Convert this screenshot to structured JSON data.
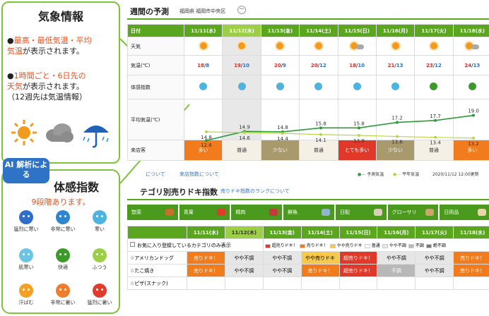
{
  "info_box": {
    "title": "気象情報",
    "b1_part1": "最高・最低気温・平均",
    "b1_part2": "気温",
    "b1_part3": "が表示されます。",
    "b2_part1": "1時間ごと・6日先の",
    "b2_part2": "天気",
    "b2_part3": "が表示されます。",
    "b2_note": "（12週先は気温情報）"
  },
  "index_box": {
    "ai_tag": "AI 解析による",
    "title": "体感指数",
    "subtitle": "9段階あります。",
    "levels": [
      "猛烈に寒い",
      "非常に寒い",
      "寒い",
      "肌寒い",
      "快適",
      "ふつう",
      "汗ばむ",
      "非常に暑い",
      "猛烈に暑い"
    ],
    "colors": [
      "#2f6fc9",
      "#2f85cf",
      "#4db3e0",
      "#6ac6e3",
      "#3c9a2a",
      "#9ccf46",
      "#f2a125",
      "#f07c2e",
      "#e03c2c"
    ]
  },
  "forecast": {
    "title": "週間の予測",
    "location": "福岡県 福岡市中央区",
    "row_labels": [
      "日付",
      "天気",
      "気温(℃)",
      "体感指数",
      "平均気温(℃)",
      "来店客"
    ],
    "dates": [
      "11/11(水)",
      "11/12(木)",
      "11/13(金)",
      "11/14(土)",
      "11/15(日)",
      "11/16(月)",
      "11/17(火)",
      "11/18(水)"
    ],
    "highs": [
      "18",
      "19",
      "20",
      "20",
      "18",
      "21",
      "23",
      "24"
    ],
    "lows": [
      "8",
      "10",
      "9",
      "12",
      "10",
      "13",
      "12",
      "13"
    ],
    "visitors": [
      "多い",
      "普通",
      "少ない",
      "普通",
      "とても多い",
      "少ない",
      "普通",
      "多い"
    ],
    "visitor_colors": [
      "#f07c1e",
      "#f5f0e6",
      "#a99a6e",
      "#f5f0e6",
      "#e0392a",
      "#a99a6e",
      "#f5f0e6",
      "#f07c1e"
    ],
    "legend_pred": "予測気温",
    "legend_avg": "平年気温",
    "updated": "2020/11/12 12:00更新",
    "link1": "について",
    "link2": "来店指数について"
  },
  "chart_data": {
    "type": "line",
    "x": [
      "11/11(水)",
      "11/12(木)",
      "11/13(金)",
      "11/14(土)",
      "11/15(日)",
      "11/16(月)",
      "11/17(火)",
      "11/18(水)"
    ],
    "series": [
      {
        "name": "予測気温",
        "values": [
          12.6,
          14.9,
          14.8,
          15.8,
          15.8,
          17.2,
          17.7,
          19.0
        ],
        "color": "#2c9a3a"
      },
      {
        "name": "平年気温",
        "values": [
          14.8,
          14.6,
          14.4,
          14.1,
          13.9,
          13.6,
          13.4,
          13.2
        ],
        "color": "#b9d64a"
      }
    ],
    "ylim": [
      11,
      20
    ]
  },
  "ranking": {
    "title": "テゴリ別売りドキ指数",
    "link": "売りドキ指数のランクについて",
    "categories": [
      "惣菜",
      "青果",
      "精肉",
      "鮮魚",
      "日配",
      "グローサリ",
      "日用品"
    ],
    "cat_icon_colors": [
      "#c96f2e",
      "#e03c2c",
      "#c43a3a",
      "#8fb5cf",
      "#d8d0b8",
      "#c9a66a",
      "#e8d6a8"
    ],
    "favorite_label": "お気に入り登録しているカテゴリのみ表示",
    "legend": [
      "超売りドキ！",
      "売りドキ！",
      "やや売りドキ",
      "普通",
      "やや不調",
      "不調",
      "絶不調"
    ],
    "legend_colors": [
      "#e0392a",
      "#f07c1e",
      "#f7c84a",
      "#ffffff",
      "#e6e6e6",
      "#b8b8b8",
      "#777777"
    ],
    "rows": [
      {
        "name": "アメリカンドッグ",
        "cells": [
          "売りドキ！",
          "やや不調",
          "やや不調",
          "やや売りドキ",
          "超売りドキ！",
          "やや不調",
          "やや不調",
          "売りドキ！"
        ]
      },
      {
        "name": "たこ焼き",
        "cells": [
          "売りドキ！",
          "やや不調",
          "やや不調",
          "売りドキ！",
          "超売りドキ！",
          "不調",
          "やや不調",
          "売りドキ！"
        ]
      },
      {
        "name": "ピザ(スナック)",
        "cells": [
          "",
          "",
          "",
          "",
          "",
          "",
          "",
          ""
        ]
      }
    ]
  }
}
